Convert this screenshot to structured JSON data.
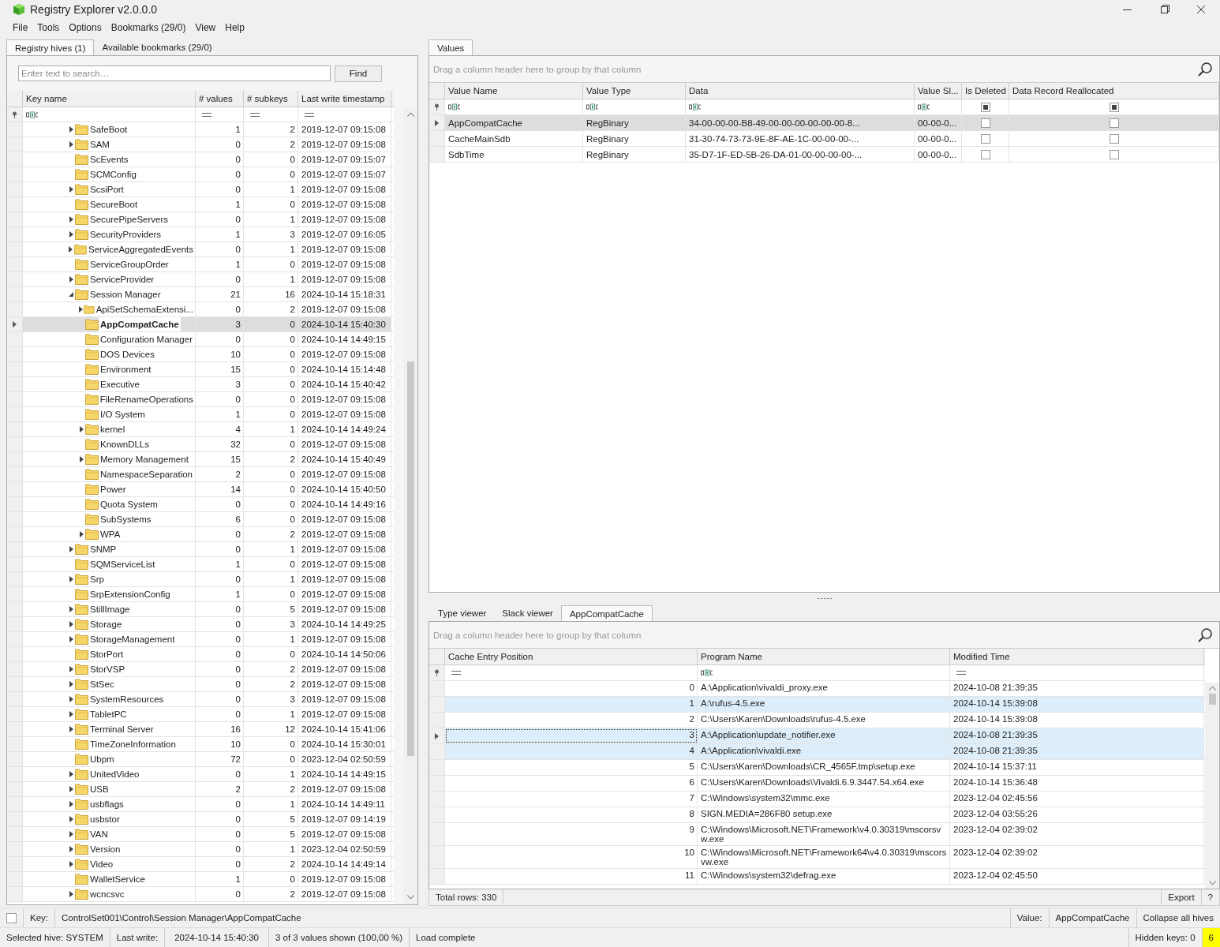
{
  "window": {
    "title": "Registry Explorer v2.0.0.0"
  },
  "menu": [
    "File",
    "Tools",
    "Options",
    "Bookmarks (29/0)",
    "View",
    "Help"
  ],
  "left_tabs": [
    {
      "label": "Registry hives (1)",
      "selected": true
    },
    {
      "label": "Available bookmarks (29/0)",
      "selected": false
    }
  ],
  "search": {
    "placeholder": "Enter text to search…",
    "button": "Find"
  },
  "key_tree": {
    "columns": [
      "Key name",
      "# values",
      "# subkeys",
      "Last write timestamp"
    ],
    "rows": [
      {
        "name": "SafeBoot",
        "values": "1",
        "subkeys": "2",
        "timestamp": "2019-12-07 09:15:08",
        "expandable": true,
        "expanded": false,
        "selected": false
      },
      {
        "name": "SAM",
        "values": "0",
        "subkeys": "2",
        "timestamp": "2019-12-07 09:15:08",
        "expandable": true,
        "expanded": false,
        "selected": false
      },
      {
        "name": "ScEvents",
        "values": "0",
        "subkeys": "0",
        "timestamp": "2019-12-07 09:15:07",
        "expandable": false,
        "expanded": false,
        "selected": false
      },
      {
        "name": "SCMConfig",
        "values": "0",
        "subkeys": "0",
        "timestamp": "2019-12-07 09:15:07",
        "expandable": false,
        "expanded": false,
        "selected": false
      },
      {
        "name": "ScsiPort",
        "values": "0",
        "subkeys": "1",
        "timestamp": "2019-12-07 09:15:08",
        "expandable": true,
        "expanded": false,
        "selected": false
      },
      {
        "name": "SecureBoot",
        "values": "1",
        "subkeys": "0",
        "timestamp": "2019-12-07 09:15:08",
        "expandable": false,
        "expanded": false,
        "selected": false
      },
      {
        "name": "SecurePipeServers",
        "values": "0",
        "subkeys": "1",
        "timestamp": "2019-12-07 09:15:08",
        "expandable": true,
        "expanded": false,
        "selected": false
      },
      {
        "name": "SecurityProviders",
        "values": "1",
        "subkeys": "3",
        "timestamp": "2019-12-07 09:16:05",
        "expandable": true,
        "expanded": false,
        "selected": false
      },
      {
        "name": "ServiceAggregatedEvents",
        "values": "0",
        "subkeys": "1",
        "timestamp": "2019-12-07 09:15:08",
        "expandable": true,
        "expanded": false,
        "selected": false
      },
      {
        "name": "ServiceGroupOrder",
        "values": "1",
        "subkeys": "0",
        "timestamp": "2019-12-07 09:15:08",
        "expandable": false,
        "expanded": false,
        "selected": false
      },
      {
        "name": "ServiceProvider",
        "values": "0",
        "subkeys": "1",
        "timestamp": "2019-12-07 09:15:08",
        "expandable": true,
        "expanded": false,
        "selected": false
      },
      {
        "name": "Session Manager",
        "values": "21",
        "subkeys": "16",
        "timestamp": "2024-10-14 15:18:31",
        "expandable": true,
        "expanded": true,
        "selected": false,
        "children": [
          {
            "name": "ApiSetSchemaExtensi...",
            "values": "0",
            "subkeys": "2",
            "timestamp": "2019-12-07 09:15:08",
            "expandable": true,
            "expanded": false,
            "selected": false
          },
          {
            "name": "AppCompatCache",
            "values": "3",
            "subkeys": "0",
            "timestamp": "2024-10-14 15:40:30",
            "expandable": false,
            "expanded": false,
            "selected": true
          },
          {
            "name": "Configuration Manager",
            "values": "0",
            "subkeys": "0",
            "timestamp": "2024-10-14 14:49:15",
            "expandable": false,
            "expanded": false,
            "selected": false
          },
          {
            "name": "DOS Devices",
            "values": "10",
            "subkeys": "0",
            "timestamp": "2019-12-07 09:15:08",
            "expandable": false,
            "expanded": false,
            "selected": false
          },
          {
            "name": "Environment",
            "values": "15",
            "subkeys": "0",
            "timestamp": "2024-10-14 15:14:48",
            "expandable": false,
            "expanded": false,
            "selected": false
          },
          {
            "name": "Executive",
            "values": "3",
            "subkeys": "0",
            "timestamp": "2024-10-14 15:40:42",
            "expandable": false,
            "expanded": false,
            "selected": false
          },
          {
            "name": "FileRenameOperations",
            "values": "0",
            "subkeys": "0",
            "timestamp": "2019-12-07 09:15:08",
            "expandable": false,
            "expanded": false,
            "selected": false
          },
          {
            "name": "I/O System",
            "values": "1",
            "subkeys": "0",
            "timestamp": "2019-12-07 09:15:08",
            "expandable": false,
            "expanded": false,
            "selected": false
          },
          {
            "name": "kernel",
            "values": "4",
            "subkeys": "1",
            "timestamp": "2024-10-14 14:49:24",
            "expandable": true,
            "expanded": false,
            "selected": false
          },
          {
            "name": "KnownDLLs",
            "values": "32",
            "subkeys": "0",
            "timestamp": "2019-12-07 09:15:08",
            "expandable": false,
            "expanded": false,
            "selected": false
          },
          {
            "name": "Memory Management",
            "values": "15",
            "subkeys": "2",
            "timestamp": "2024-10-14 15:40:49",
            "expandable": true,
            "expanded": false,
            "selected": false
          },
          {
            "name": "NamespaceSeparation",
            "values": "2",
            "subkeys": "0",
            "timestamp": "2019-12-07 09:15:08",
            "expandable": false,
            "expanded": false,
            "selected": false
          },
          {
            "name": "Power",
            "values": "14",
            "subkeys": "0",
            "timestamp": "2024-10-14 15:40:50",
            "expandable": false,
            "expanded": false,
            "selected": false
          },
          {
            "name": "Quota System",
            "values": "0",
            "subkeys": "0",
            "timestamp": "2024-10-14 14:49:16",
            "expandable": false,
            "expanded": false,
            "selected": false
          },
          {
            "name": "SubSystems",
            "values": "6",
            "subkeys": "0",
            "timestamp": "2019-12-07 09:15:08",
            "expandable": false,
            "expanded": false,
            "selected": false
          },
          {
            "name": "WPA",
            "values": "0",
            "subkeys": "2",
            "timestamp": "2019-12-07 09:15:08",
            "expandable": true,
            "expanded": false,
            "selected": false
          }
        ]
      },
      {
        "name": "SNMP",
        "values": "0",
        "subkeys": "1",
        "timestamp": "2019-12-07 09:15:08",
        "expandable": true,
        "expanded": false,
        "selected": false
      },
      {
        "name": "SQMServiceList",
        "values": "1",
        "subkeys": "0",
        "timestamp": "2019-12-07 09:15:08",
        "expandable": false,
        "expanded": false,
        "selected": false
      },
      {
        "name": "Srp",
        "values": "0",
        "subkeys": "1",
        "timestamp": "2019-12-07 09:15:08",
        "expandable": true,
        "expanded": false,
        "selected": false
      },
      {
        "name": "SrpExtensionConfig",
        "values": "1",
        "subkeys": "0",
        "timestamp": "2019-12-07 09:15:08",
        "expandable": false,
        "expanded": false,
        "selected": false
      },
      {
        "name": "StillImage",
        "values": "0",
        "subkeys": "5",
        "timestamp": "2019-12-07 09:15:08",
        "expandable": true,
        "expanded": false,
        "selected": false
      },
      {
        "name": "Storage",
        "values": "0",
        "subkeys": "3",
        "timestamp": "2024-10-14 14:49:25",
        "expandable": true,
        "expanded": false,
        "selected": false
      },
      {
        "name": "StorageManagement",
        "values": "0",
        "subkeys": "1",
        "timestamp": "2019-12-07 09:15:08",
        "expandable": true,
        "expanded": false,
        "selected": false
      },
      {
        "name": "StorPort",
        "values": "0",
        "subkeys": "0",
        "timestamp": "2024-10-14 14:50:06",
        "expandable": false,
        "expanded": false,
        "selected": false
      },
      {
        "name": "StorVSP",
        "values": "0",
        "subkeys": "2",
        "timestamp": "2019-12-07 09:15:08",
        "expandable": true,
        "expanded": false,
        "selected": false
      },
      {
        "name": "StSec",
        "values": "0",
        "subkeys": "2",
        "timestamp": "2019-12-07 09:15:08",
        "expandable": true,
        "expanded": false,
        "selected": false
      },
      {
        "name": "SystemResources",
        "values": "0",
        "subkeys": "3",
        "timestamp": "2019-12-07 09:15:08",
        "expandable": true,
        "expanded": false,
        "selected": false
      },
      {
        "name": "TabletPC",
        "values": "0",
        "subkeys": "1",
        "timestamp": "2019-12-07 09:15:08",
        "expandable": true,
        "expanded": false,
        "selected": false
      },
      {
        "name": "Terminal Server",
        "values": "16",
        "subkeys": "12",
        "timestamp": "2024-10-14 15:41:06",
        "expandable": true,
        "expanded": false,
        "selected": false
      },
      {
        "name": "TimeZoneInformation",
        "values": "10",
        "subkeys": "0",
        "timestamp": "2024-10-14 15:30:01",
        "expandable": false,
        "expanded": false,
        "selected": false
      },
      {
        "name": "Ubpm",
        "values": "72",
        "subkeys": "0",
        "timestamp": "2023-12-04 02:50:59",
        "expandable": false,
        "expanded": false,
        "selected": false
      },
      {
        "name": "UnitedVideo",
        "values": "0",
        "subkeys": "1",
        "timestamp": "2024-10-14 14:49:15",
        "expandable": true,
        "expanded": false,
        "selected": false
      },
      {
        "name": "USB",
        "values": "2",
        "subkeys": "2",
        "timestamp": "2019-12-07 09:15:08",
        "expandable": true,
        "expanded": false,
        "selected": false
      },
      {
        "name": "usbflags",
        "values": "0",
        "subkeys": "1",
        "timestamp": "2024-10-14 14:49:11",
        "expandable": true,
        "expanded": false,
        "selected": false
      },
      {
        "name": "usbstor",
        "values": "0",
        "subkeys": "5",
        "timestamp": "2019-12-07 09:14:19",
        "expandable": true,
        "expanded": false,
        "selected": false
      },
      {
        "name": "VAN",
        "values": "0",
        "subkeys": "5",
        "timestamp": "2019-12-07 09:15:08",
        "expandable": true,
        "expanded": false,
        "selected": false
      },
      {
        "name": "Version",
        "values": "0",
        "subkeys": "1",
        "timestamp": "2023-12-04 02:50:59",
        "expandable": true,
        "expanded": false,
        "selected": false
      },
      {
        "name": "Video",
        "values": "0",
        "subkeys": "2",
        "timestamp": "2024-10-14 14:49:14",
        "expandable": true,
        "expanded": false,
        "selected": false
      },
      {
        "name": "WalletService",
        "values": "1",
        "subkeys": "0",
        "timestamp": "2019-12-07 09:15:08",
        "expandable": false,
        "expanded": false,
        "selected": false
      },
      {
        "name": "wcncsvc",
        "values": "0",
        "subkeys": "2",
        "timestamp": "2019-12-07 09:15:08",
        "expandable": true,
        "expanded": false,
        "selected": false
      }
    ]
  },
  "values_panel": {
    "tab": "Values",
    "group_hint": "Drag a column header here to group by that column",
    "columns": [
      "Value Name",
      "Value Type",
      "Data",
      "Value Sl...",
      "Is Deleted",
      "Data Record Reallocated"
    ],
    "filter_checkboxes": [
      {
        "checked": true
      },
      {
        "checked": true
      }
    ],
    "rows": [
      {
        "name": "AppCompatCache",
        "type": "RegBinary",
        "data": "34-00-00-00-B8-49-00-00-00-00-00-00-8...",
        "slack": "00-00-0...",
        "is_deleted": false,
        "reallocated": false,
        "selected": true
      },
      {
        "name": "CacheMainSdb",
        "type": "RegBinary",
        "data": "31-30-74-73-73-9E-8F-AE-1C-00-00-00-...",
        "slack": "00-00-0...",
        "is_deleted": false,
        "reallocated": false,
        "selected": false
      },
      {
        "name": "SdbTime",
        "type": "RegBinary",
        "data": "35-D7-1F-ED-5B-26-DA-01-00-00-00-00-...",
        "slack": "00-00-0...",
        "is_deleted": false,
        "reallocated": false,
        "selected": false
      }
    ]
  },
  "viewer_tabs": [
    {
      "label": "Type viewer",
      "selected": false
    },
    {
      "label": "Slack viewer",
      "selected": false
    },
    {
      "label": "AppCompatCache",
      "selected": true
    }
  ],
  "cache_grid": {
    "group_hint": "Drag a column header here to group by that column",
    "columns": [
      "Cache Entry Position",
      "Program Name",
      "Modified Time"
    ],
    "rows": [
      {
        "entry": "0",
        "program": "A:\\Application\\vivaldi_proxy.exe",
        "modified": "2024-10-08 21:39:35",
        "selected": false,
        "focused": false
      },
      {
        "entry": "1",
        "program": "A:\\rufus-4.5.exe",
        "modified": "2024-10-14 15:39:08",
        "selected": true,
        "focused": false
      },
      {
        "entry": "2",
        "program": "C:\\Users\\Karen\\Downloads\\rufus-4.5.exe",
        "modified": "2024-10-14 15:39:08",
        "selected": false,
        "focused": false
      },
      {
        "entry": "3",
        "program": "A:\\Application\\update_notifier.exe",
        "modified": "2024-10-08 21:39:35",
        "selected": true,
        "focused": true
      },
      {
        "entry": "4",
        "program": "A:\\Application\\vivaldi.exe",
        "modified": "2024-10-08 21:39:35",
        "selected": true,
        "focused": false
      },
      {
        "entry": "5",
        "program": "C:\\Users\\Karen\\Downloads\\CR_4565F.tmp\\setup.exe",
        "modified": "2024-10-14 15:37:11",
        "selected": false,
        "focused": false
      },
      {
        "entry": "6",
        "program": "C:\\Users\\Karen\\Downloads\\Vivaldi.6.9.3447.54.x64.exe",
        "modified": "2024-10-14 15:36:48",
        "selected": false,
        "focused": false
      },
      {
        "entry": "7",
        "program": "C:\\Windows\\system32\\mmc.exe",
        "modified": "2023-12-04 02:45:56",
        "selected": false,
        "focused": false
      },
      {
        "entry": "8",
        "program": "SIGN.MEDIA=286F80 setup.exe",
        "modified": "2023-12-04 03:55:26",
        "selected": false,
        "focused": false
      },
      {
        "entry": "9",
        "program": "C:\\Windows\\Microsoft.NET\\Framework\\v4.0.30319\\mscorsvw.exe",
        "modified": "2023-12-04 02:39:02",
        "selected": false,
        "focused": false
      },
      {
        "entry": "10",
        "program": "C:\\Windows\\Microsoft.NET\\Framework64\\v4.0.30319\\mscorsvw.exe",
        "modified": "2023-12-04 02:39:02",
        "selected": false,
        "focused": false
      },
      {
        "entry": "11",
        "program": "C:\\Windows\\system32\\defrag.exe",
        "modified": "2023-12-04 02:45:50",
        "selected": false,
        "focused": false
      }
    ],
    "total": "Total rows: 330",
    "export": "Export",
    "help": "?"
  },
  "status": {
    "checked": false,
    "key_label": "Key:",
    "key_path": "ControlSet001\\Control\\Session Manager\\AppCompatCache",
    "value_label": "Value:",
    "value": "AppCompatCache",
    "collapse": "Collapse all hives",
    "selected_hive": "Selected hive: SYSTEM",
    "last_write_label": "Last write:",
    "last_write": "2024-10-14 15:40:30",
    "shown": "3 of 3 values shown (100,00 %)",
    "load": "Load complete",
    "hidden": "Hidden keys: 0",
    "badge": "6"
  }
}
